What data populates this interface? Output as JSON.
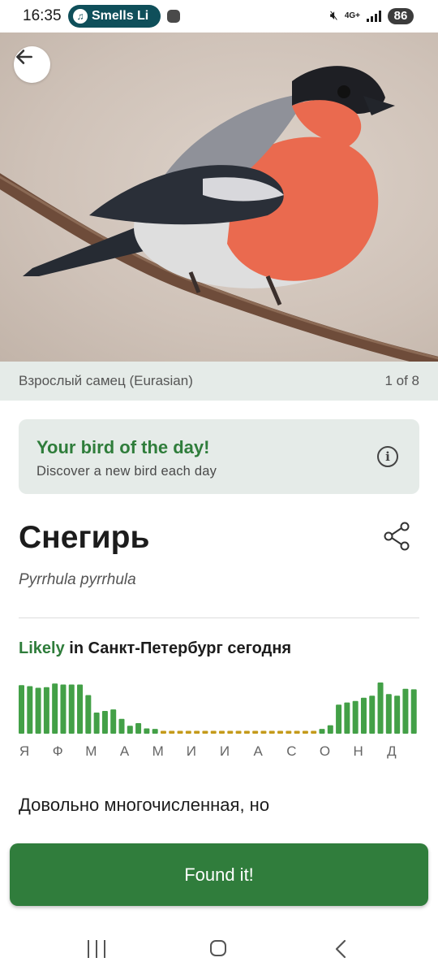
{
  "status_bar": {
    "time": "16:35",
    "media_label": "Smells Li",
    "network": "4G+",
    "battery": "86"
  },
  "photo": {
    "caption": "Взрослый самец (Eurasian)",
    "counter": "1 of 8"
  },
  "bird_of_day": {
    "title": "Your bird of the day!",
    "subtitle": "Discover a new bird each day"
  },
  "species": {
    "common_name": "Снегирь",
    "scientific_name": "Pyrrhula pyrrhula"
  },
  "likelihood": {
    "status": "Likely",
    "location_text": " in Санкт-Петербург сегодня"
  },
  "chart_data": {
    "type": "bar",
    "xlabels": [
      "Я",
      "Ф",
      "М",
      "А",
      "М",
      "И",
      "И",
      "А",
      "С",
      "О",
      "Н",
      "Д"
    ],
    "values": [
      0.92,
      0.9,
      0.87,
      0.88,
      0.95,
      0.93,
      0.93,
      0.93,
      0.73,
      0.4,
      0.43,
      0.46,
      0.28,
      0.15,
      0.2,
      0.1,
      0.09,
      0.04,
      0.04,
      0.06,
      0.05,
      0.04,
      0.04,
      0.04,
      0.04,
      0.05,
      0.03,
      0.04,
      0.02,
      0.02,
      0.02,
      0.03,
      0.04,
      0.05,
      0.05,
      0.04,
      0.09,
      0.16,
      0.55,
      0.59,
      0.62,
      0.68,
      0.72,
      0.97,
      0.75,
      0.72,
      0.85,
      0.84
    ],
    "colors": {
      "likely": "#43a047",
      "unlikely": "#c49a1a"
    }
  },
  "description": "Довольно многочисленная, но",
  "primary_button": "Found it!",
  "colors": {
    "accent_green": "#2f7d3b",
    "button_green": "#307d3c",
    "card_bg": "#e5ebe8"
  }
}
